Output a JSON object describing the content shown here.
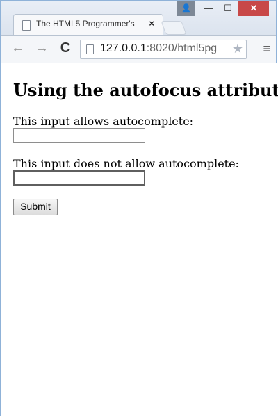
{
  "browser": {
    "tab_title": "The HTML5 Programmer's",
    "tab_close": "×",
    "url_host": "127.0.0.1",
    "url_path": ":8020/html5pg",
    "window_controls": {
      "user": "👤",
      "minimize": "—",
      "maximize": "☐",
      "close": "✕"
    },
    "toolbar": {
      "back": "←",
      "forward": "→",
      "reload": "C",
      "star": "★",
      "menu": "≡"
    }
  },
  "page": {
    "heading": "Using the autofocus attribute",
    "input1_label": "This input allows autocomplete:",
    "input1_value": "",
    "input2_label": "This input does not allow autocomplete:",
    "input2_value": "",
    "submit_label": "Submit"
  },
  "colors": {
    "window_close": "#c84848",
    "page_background": "#ffffff"
  }
}
